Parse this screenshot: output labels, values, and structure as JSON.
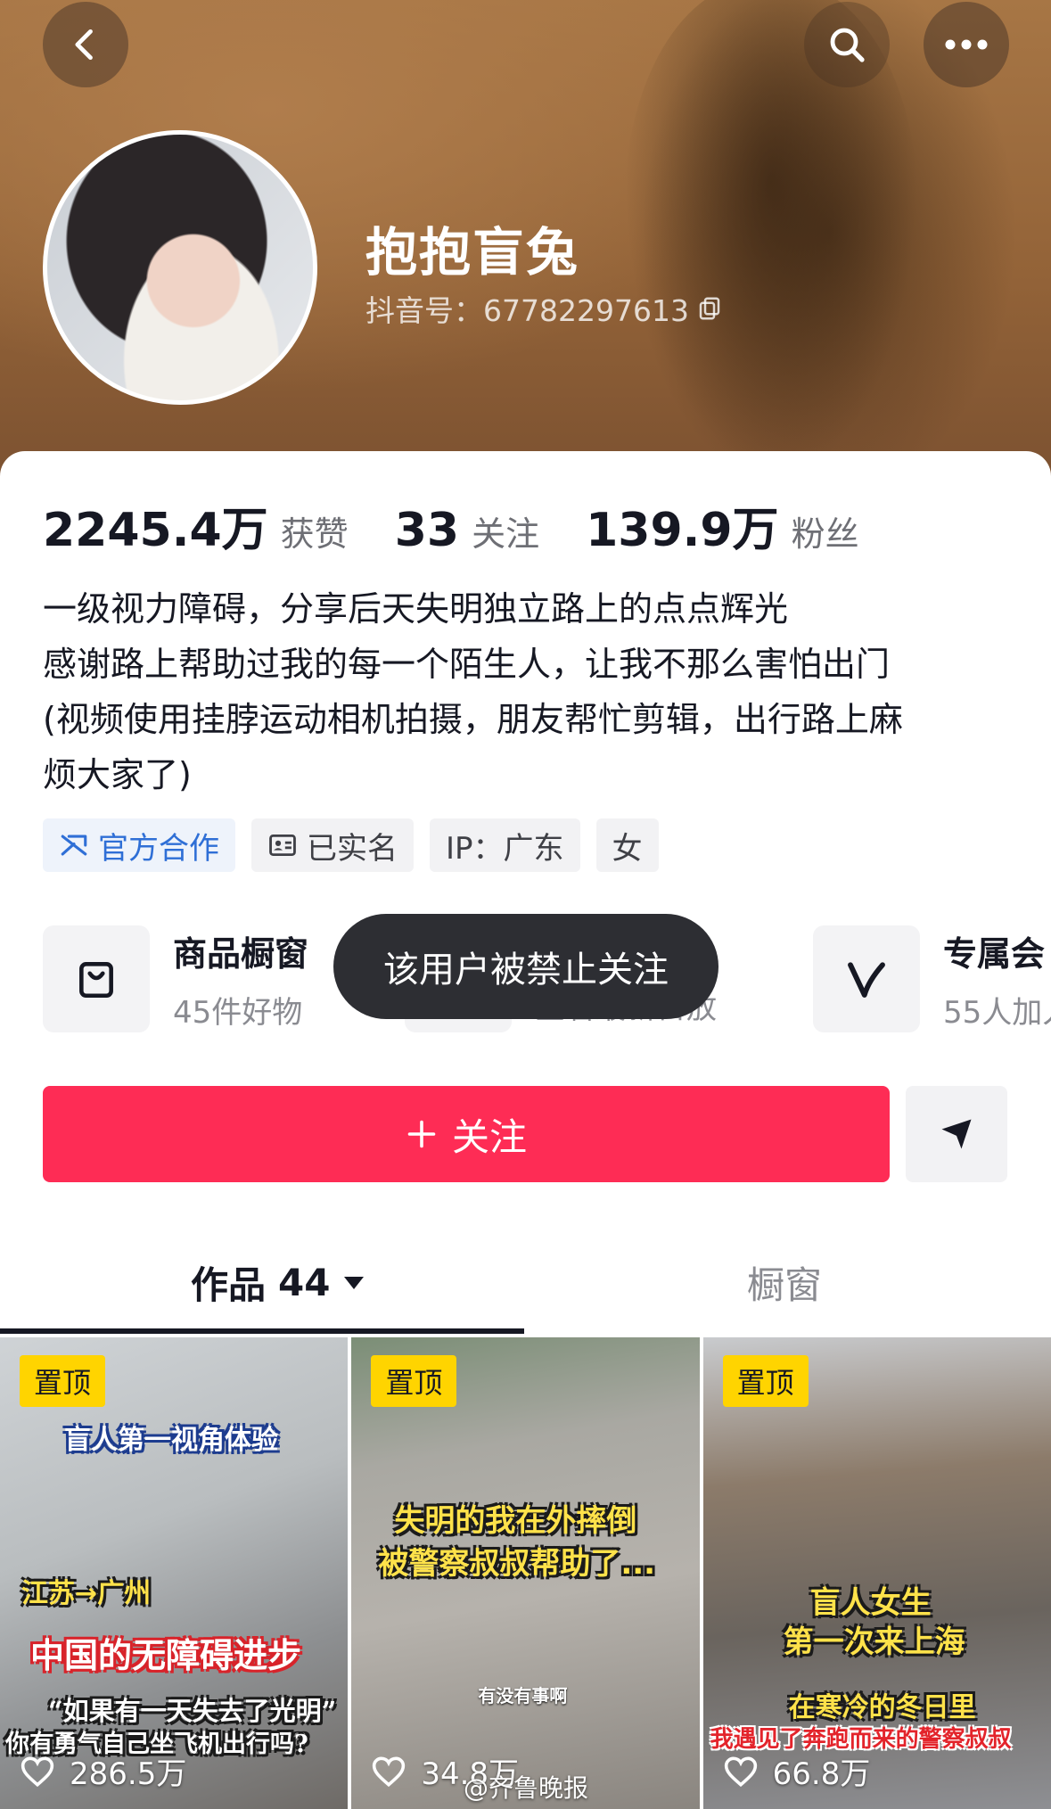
{
  "header": {
    "nickname": "抱抱盲兔",
    "douyin_id": "抖音号：67782297613"
  },
  "stats": [
    {
      "value": "2245.4万",
      "label": "获赞"
    },
    {
      "value": "33",
      "label": "关注"
    },
    {
      "value": "139.9万",
      "label": "粉丝"
    }
  ],
  "bio": [
    "一级视力障碍，分享后天失明独立路上的点点辉光",
    "感谢路上帮助过我的每一个陌生人，让我不那么害怕出门",
    "(视频使用挂脖运动相机拍摄，朋友帮忙剪辑，出行路上麻",
    "烦大家了)"
  ],
  "tags": [
    {
      "label": "官方合作",
      "icon": "official-cooperation-icon"
    },
    {
      "label": "已实名",
      "icon": "id-card-icon"
    },
    {
      "label": "IP：广东"
    },
    {
      "label": "女"
    }
  ],
  "services": [
    {
      "title": "商品橱窗",
      "sub": "45件好物",
      "icon": "shopping-bag-icon"
    },
    {
      "sub": "查看最新日放"
    },
    {
      "title": "专属会",
      "sub": "55人加入",
      "icon": "vip-v-icon"
    }
  ],
  "toast": "该用户被禁止关注",
  "actions": {
    "follow_label": "关注",
    "follow_color": "#fe2c55"
  },
  "tabs": {
    "works_label": "作品",
    "works_count": "44",
    "showcase_label": "橱窗"
  },
  "videos": [
    {
      "pin": "置顶",
      "captions": [
        "盲人第一视角体验",
        "江苏→广州",
        "中国的无障碍进步",
        "“如果有一天失去了光明”",
        "你有勇气自己坐飞机出行吗?"
      ],
      "likes": "286.5万"
    },
    {
      "pin": "置顶",
      "captions": [
        "失明的我在外摔倒",
        "被警察叔叔帮助了...",
        "有没有事啊"
      ],
      "likes": "34.8万"
    },
    {
      "pin": "置顶",
      "captions": [
        "盲人女生",
        "第一次来上海",
        "在寒冷的冬日里",
        "我遇见了奔跑而来的警察叔叔"
      ],
      "likes": "66.8万"
    }
  ],
  "watermark": "@齐鲁晚报"
}
